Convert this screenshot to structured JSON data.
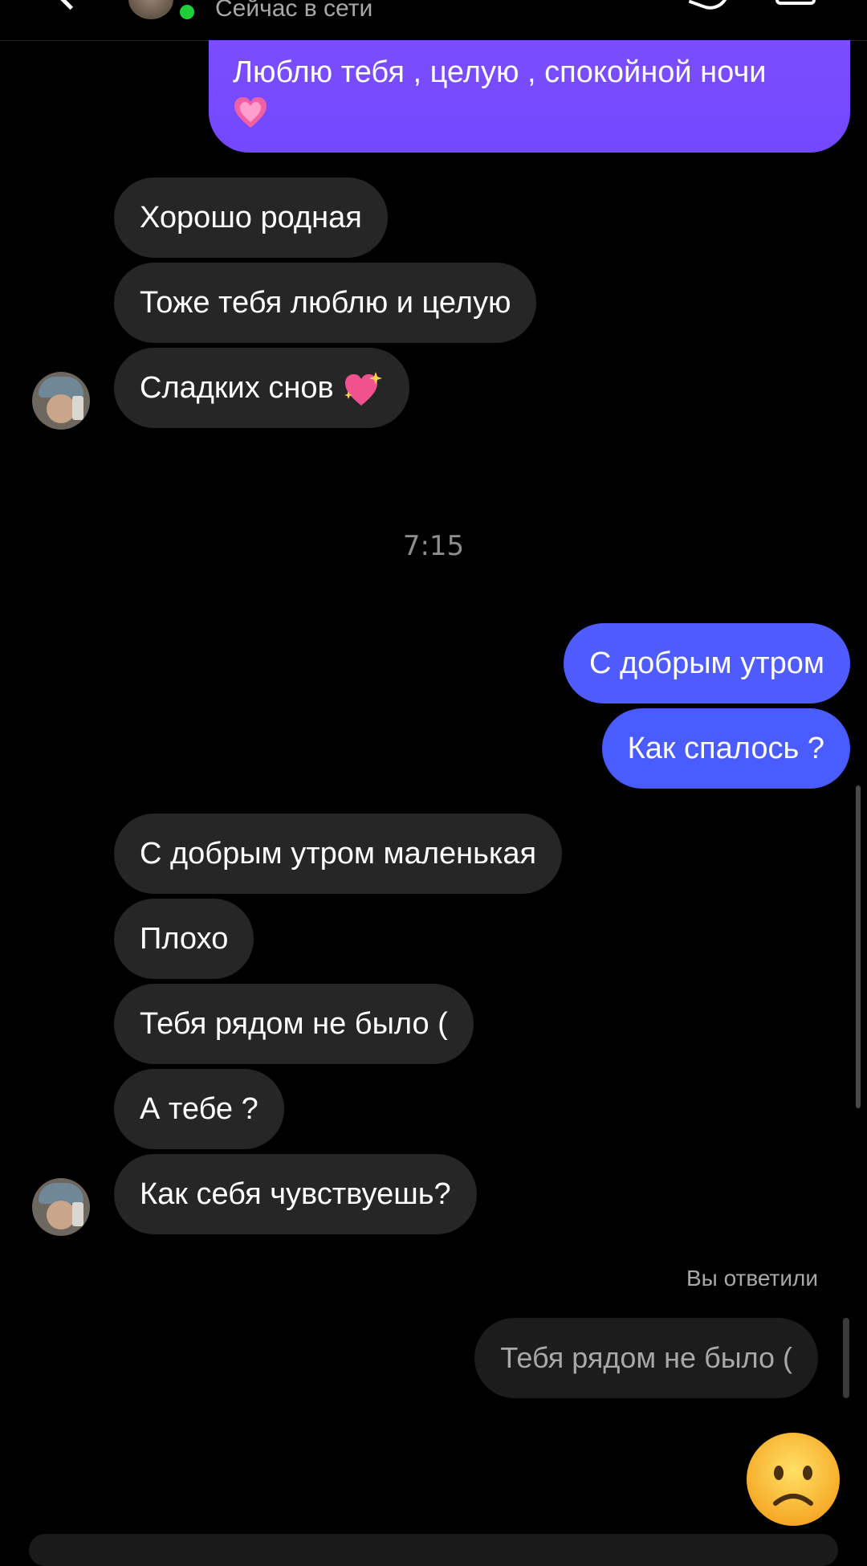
{
  "header": {
    "status": "Сейчас в сети"
  },
  "colors": {
    "background": "#000000",
    "incoming_bubble": "#262626",
    "outgoing_bubble_top": "#7b4dff",
    "outgoing_bubble_bottom": "#4f5cff",
    "online_dot": "#1fcf3a"
  },
  "messages_top": {
    "outgoing_1": "Люблю тебя , целую , спокойной ночи",
    "outgoing_1_emoji": "heart-emoji",
    "incoming_1": "Хорошо родная",
    "incoming_2": "Тоже тебя люблю и целую",
    "incoming_3": "Сладких снов",
    "incoming_3_emoji": "sparkling-heart-emoji"
  },
  "timestamp": "7:15",
  "messages_morning": {
    "outgoing_1": "С добрым утром",
    "outgoing_2": "Как спалось ?",
    "incoming_1": "С добрым утром маленькая",
    "incoming_2": "Плохо",
    "incoming_3": "Тебя рядом не было (",
    "incoming_4": "А тебе ?",
    "incoming_5": "Как себя чувствуешь?"
  },
  "reply": {
    "label": "Вы ответили",
    "quoted": "Тебя рядом не было ("
  },
  "sent_emoji": "sad-face-emoji"
}
